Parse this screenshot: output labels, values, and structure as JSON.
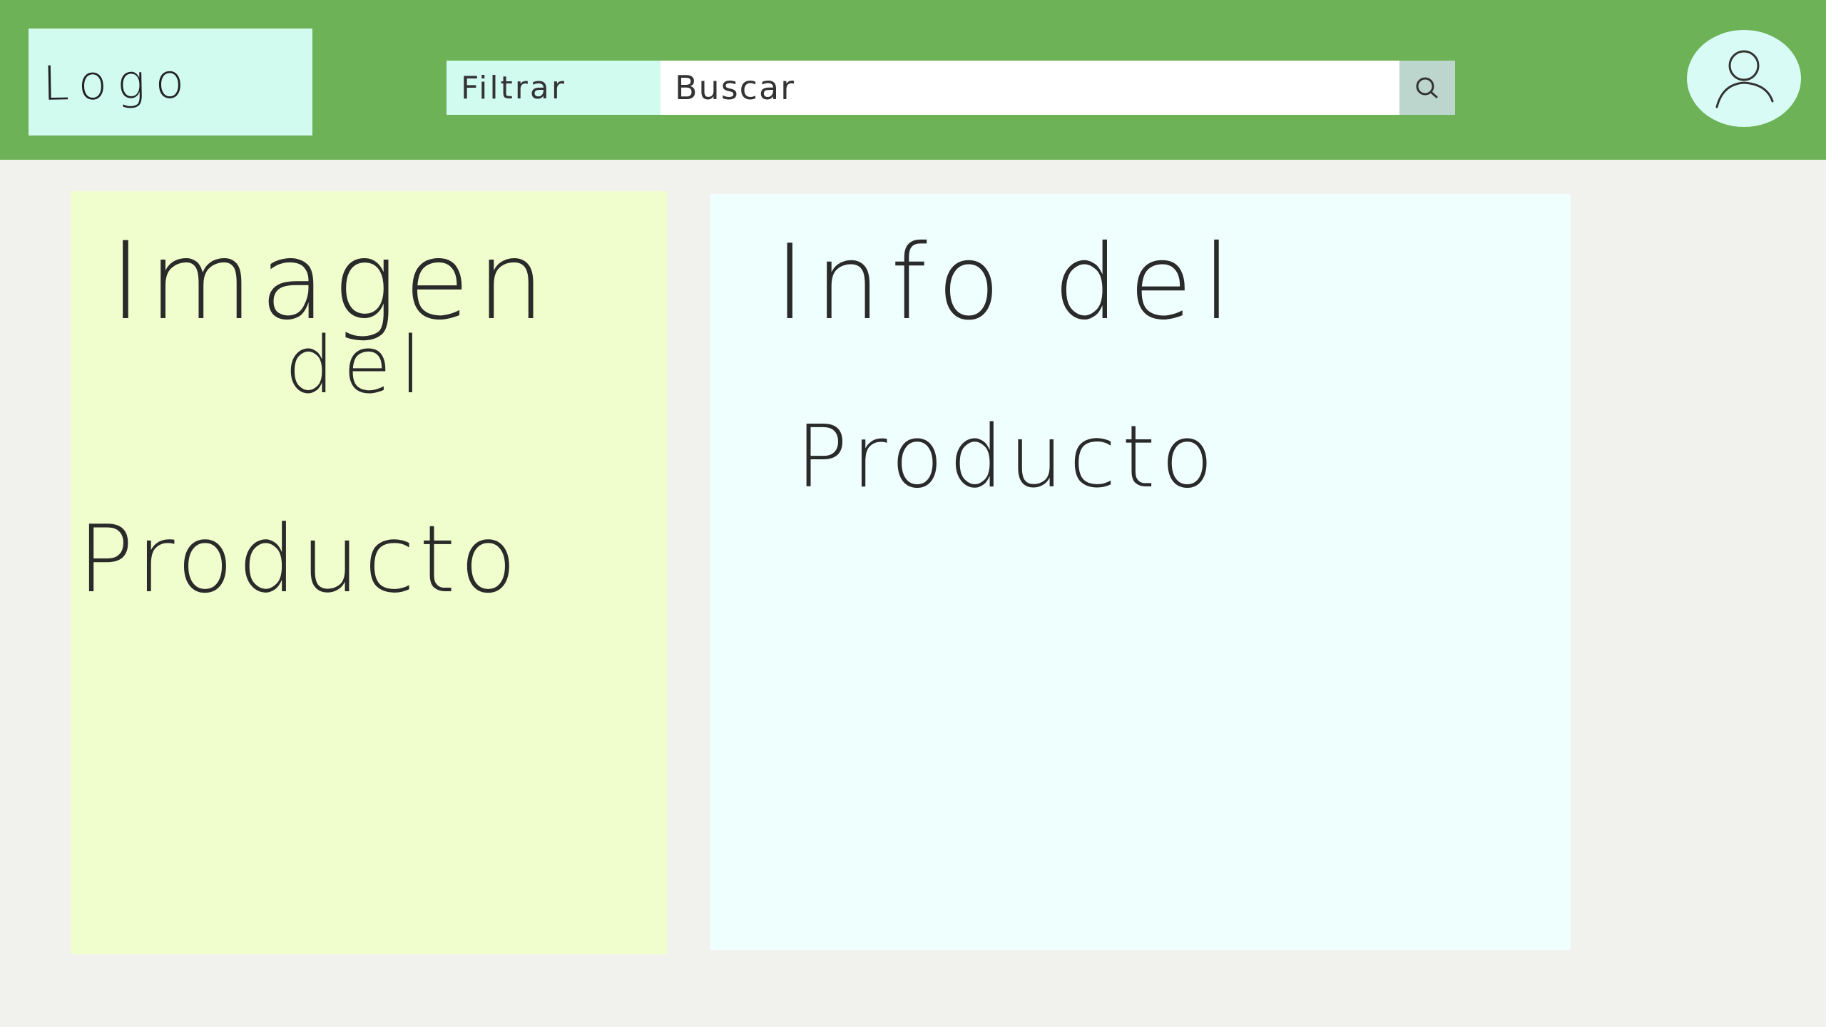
{
  "header": {
    "logo_label": "Logo",
    "filter_label": "Filtrar",
    "search_placeholder": "Buscar",
    "search_icon": "search-icon",
    "avatar_icon": "user-icon"
  },
  "product_image_panel": {
    "lines": [
      "Imagen",
      "del",
      "Producto"
    ]
  },
  "product_info_panel": {
    "lines": [
      "Info del",
      "Producto"
    ]
  },
  "colors": {
    "header_bg": "#6db257",
    "logo_bg": "#d1fbee",
    "filter_bg": "#d1fbee",
    "search_button_bg": "#bdd6cd",
    "avatar_bg": "#d9fbf5",
    "image_panel_bg": "#f0fecd",
    "info_panel_bg": "#effffd",
    "page_bg": "#f1f1ed"
  }
}
